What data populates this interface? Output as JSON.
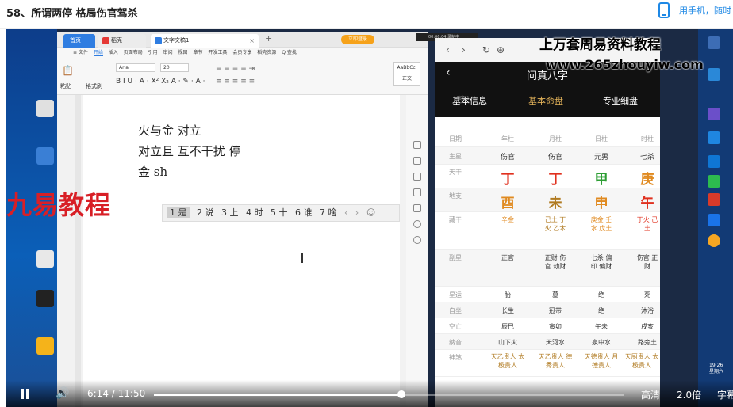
{
  "header": {
    "title": "58、所谓两停 格局伤官驾杀",
    "phone_text": "用手机，随时"
  },
  "wps": {
    "tabs": {
      "home": "首页",
      "template": "稻壳",
      "doc": "文字文稿1",
      "close": "×",
      "plus": "+"
    },
    "login": "立即登录",
    "recorder": "00:06:04 录制中",
    "menu": [
      "≡ 文件",
      "开始",
      "插入",
      "页面布局",
      "引用",
      "审阅",
      "视图",
      "章节",
      "开发工具",
      "会员专享",
      "稻壳资源",
      "Q 查找"
    ],
    "ribbon": {
      "font": "Arial",
      "size": "20",
      "paste": "粘贴",
      "format": "格式刷",
      "style": "AaBbCcI",
      "style_name": "正文",
      "buttons": "B I U · A · X² X₂ A · ✎ · A ·"
    },
    "lines": [
      "火与金 对立",
      "对立且 互不干扰 停",
      "金 sh"
    ],
    "ime": {
      "candidates": [
        "1 是",
        "2 说",
        "3 上",
        "4 时",
        "5 十",
        "6 谁",
        "7 啥"
      ],
      "prev": "‹",
      "next": "›"
    }
  },
  "watermarks": {
    "red": "九易教程",
    "w1": "上万套周易资料教程",
    "w2": "www.265zhouyiw.com"
  },
  "app": {
    "title": "问真八字",
    "back": "‹",
    "tabs": [
      "基本信息",
      "基本命盘",
      "专业细盘"
    ],
    "sub": "案例1",
    "columns": [
      "年柱",
      "月柱",
      "日柱",
      "时柱"
    ],
    "rows": [
      {
        "label": "日期",
        "cells": [
          "年柱",
          "月柱",
          "日柱",
          "时柱"
        ]
      },
      {
        "label": "主星",
        "cells": [
          "伤官",
          "伤官",
          "元男",
          "七杀"
        ]
      },
      {
        "label": "天干",
        "cells": [
          "丁",
          "丁",
          "甲",
          "庚"
        ]
      },
      {
        "label": "地支",
        "cells": [
          "酉",
          "未",
          "申",
          "午"
        ]
      },
      {
        "label": "藏干",
        "cells": [
          "辛金",
          "己土 丁火 乙木",
          "庚金 壬水 戊土",
          "丁火 己土"
        ]
      },
      {
        "label": "副星",
        "cells": [
          "正官",
          "正财 伤官 劫财",
          "七杀 偏印 偏财",
          "伤官 正财"
        ]
      },
      {
        "label": "星运",
        "cells": [
          "胎",
          "墓",
          "绝",
          "死"
        ]
      },
      {
        "label": "自坐",
        "cells": [
          "长生",
          "冠带",
          "绝",
          "沐浴"
        ]
      },
      {
        "label": "空亡",
        "cells": [
          "辰巳",
          "寅卯",
          "午未",
          "戌亥"
        ]
      },
      {
        "label": "纳音",
        "cells": [
          "山下火",
          "天河水",
          "泉中水",
          "路旁土"
        ]
      },
      {
        "label": "神煞",
        "cells": [
          "天乙贵人 太极贵人",
          "天乙贵人 德秀贵人",
          "天德贵人 月德贵人",
          "天厨贵人 太极贵人"
        ]
      }
    ]
  },
  "clock": {
    "time": "19:26",
    "day": "星期六"
  },
  "player": {
    "current": "6:14",
    "total": "11:50",
    "sep": "/",
    "progress": 0.527,
    "hd": "高清",
    "speed": "2.0倍",
    "subtitle": "字幕"
  }
}
